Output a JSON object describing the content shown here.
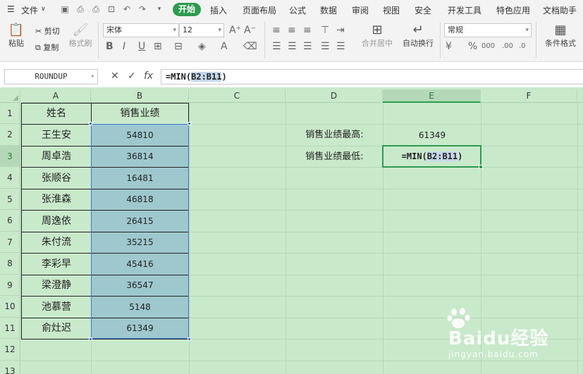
{
  "menu": {
    "file_label": "文件",
    "tabs": [
      "开始",
      "插入",
      "页面布局",
      "公式",
      "数据",
      "审阅",
      "视图",
      "安全",
      "开发工具",
      "特色应用",
      "文档助手"
    ],
    "active_tab": "开始"
  },
  "toolbar": {
    "paste_label": "粘贴",
    "cut_label": "剪切",
    "copy_label": "复制",
    "format_painter_label": "格式刷",
    "font_name": "宋体",
    "font_size": "12",
    "merge_center_label": "合并居中",
    "wrap_text_label": "自动换行",
    "number_format": "常规",
    "conditional_format_label": "条件格式"
  },
  "formula_bar": {
    "name_box": "ROUNDUP",
    "formula_prefix": "=MIN(",
    "formula_ref": "B2:B11",
    "formula_suffix": ")"
  },
  "columns": [
    "A",
    "B",
    "C",
    "D",
    "E",
    "F"
  ],
  "selected_column": "E",
  "rows": [
    "1",
    "2",
    "3",
    "4",
    "5",
    "6",
    "7",
    "8",
    "9",
    "10",
    "11",
    "12",
    "13"
  ],
  "selected_row": "3",
  "table": {
    "header_name": "姓名",
    "header_sales": "销售业绩",
    "rows": [
      {
        "name": "王生安",
        "sales": "54810"
      },
      {
        "name": "周卓浩",
        "sales": "36814"
      },
      {
        "name": "张顺谷",
        "sales": "16481"
      },
      {
        "name": "张淮森",
        "sales": "46818"
      },
      {
        "name": "周逸依",
        "sales": "26415"
      },
      {
        "name": "朱付流",
        "sales": "35215"
      },
      {
        "name": "李彩早",
        "sales": "45416"
      },
      {
        "name": "梁澄静",
        "sales": "36547"
      },
      {
        "name": "池慕营",
        "sales": "5148"
      },
      {
        "name": "俞灶迟",
        "sales": "61349"
      }
    ]
  },
  "summary": {
    "max_label": "销售业绩最高:",
    "max_value": "61349",
    "min_label": "销售业绩最低:",
    "min_formula_prefix": "=MIN(",
    "min_formula_ref": "B2:B11",
    "min_formula_suffix": ")"
  },
  "watermark": {
    "brand": "Baidu经验",
    "url": "jingyan.baidu.com"
  },
  "colors": {
    "accent": "#2e9b4e",
    "sheet_bg": "#c9e9cb",
    "range_fill": "#9ec8ce",
    "range_border": "#3b78d0"
  }
}
